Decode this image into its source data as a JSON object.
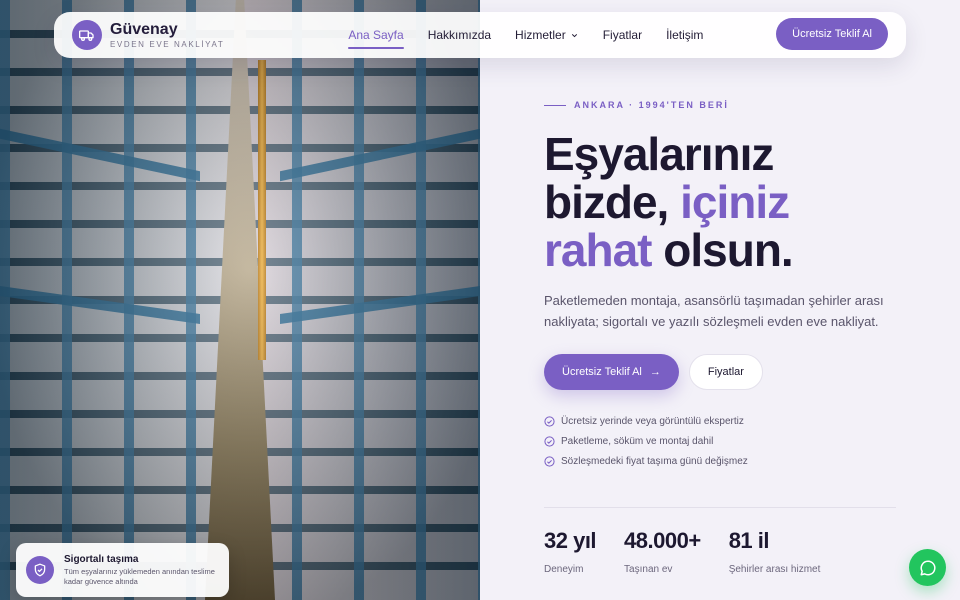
{
  "brand": {
    "name": "Güvenay",
    "tagline": "EVDEN EVE NAKLİYAT",
    "logo_icon": "truck-icon",
    "accent": "#7a5fc4"
  },
  "nav": {
    "items": [
      {
        "label": "Ana Sayfa",
        "active": true
      },
      {
        "label": "Hakkımızda"
      },
      {
        "label": "Hizmetler",
        "has_dropdown": true
      },
      {
        "label": "Fiyatlar"
      },
      {
        "label": "İletişim"
      }
    ],
    "cta": "Ücretsiz Teklif Al"
  },
  "hero": {
    "eyebrow": "ANKARA · 1994'TEN BERİ",
    "headline": {
      "line1": "Eşyalarınız",
      "line2_a": "bizde, ",
      "line2_b": "içiniz",
      "line3_a": "rahat",
      "line3_b": " olsun."
    },
    "lead": "Paketlemeden montaja, asansörlü taşımadan şehirler arası nakliyata; sigortalı ve yazılı sözleşmeli evden eve nakliyat.",
    "primary_cta": "Ücretsiz Teklif Al",
    "secondary_cta": "Fiyatlar",
    "checks": [
      "Ücretsiz yerinde veya görüntülü ekspertiz",
      "Paketleme, söküm ve montaj dahil",
      "Sözleşmedeki fiyat taşıma günü değişmez"
    ]
  },
  "stats": [
    {
      "value": "32 yıl",
      "label": "Deneyim"
    },
    {
      "value": "48.000+",
      "label": "Taşınan ev"
    },
    {
      "value": "81 il",
      "label": "Şehirler arası hizmet"
    }
  ],
  "toast": {
    "title": "Sigortalı taşıma",
    "text": "Tüm eşyalarınız yüklemeden anından teslime kadar güvence altında",
    "icon": "shield-check-icon"
  },
  "whatsapp": {
    "icon": "chat-bubble-icon",
    "color": "#22c55e"
  }
}
